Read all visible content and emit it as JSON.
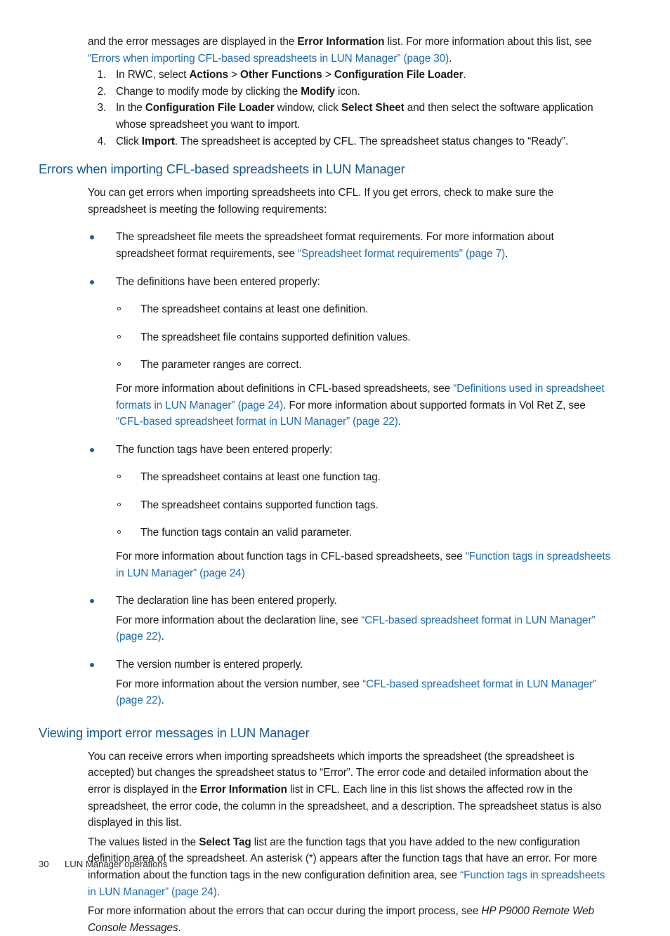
{
  "document": {
    "footer": {
      "page_number": "30",
      "chapter": "LUN Manager operations"
    }
  },
  "intro": {
    "line_a": "and the error messages are displayed in the ",
    "bold_a": "Error Information",
    "line_b": " list. For more information about this list, see ",
    "link_a": "“Errors when importing CFL-based spreadsheets in LUN Manager” (page 30)",
    "line_c": "."
  },
  "steps": [
    {
      "num": "1.",
      "pre": "In RWC, select ",
      "b1": "Actions",
      "sep1": " > ",
      "b2": "Other Functions",
      "sep2": " > ",
      "b3": "Configuration File Loader",
      "post": "."
    },
    {
      "num": "2.",
      "pre": "Change to modify mode by clicking the ",
      "b1": "Modify",
      "post": " icon."
    },
    {
      "num": "3.",
      "pre": "In the ",
      "b1": "Configuration File Loader",
      "mid": " window, click ",
      "b2": "Select Sheet",
      "post": " and then select the software application whose spreadsheet you want to import."
    },
    {
      "num": "4.",
      "pre": "Click ",
      "b1": "Import",
      "post": ". The spreadsheet is accepted by CFL. The spreadsheet status changes to “Ready”."
    }
  ],
  "section1": {
    "heading": "Errors when importing CFL-based spreadsheets in LUN Manager",
    "lead": "You can get errors when importing spreadsheets into CFL. If you get errors, check to make sure the spreadsheet is meeting the following requirements:",
    "bullet1": {
      "text": "The spreadsheet file meets the spreadsheet format requirements. For more information about spreadsheet format requirements, see ",
      "link": "“Spreadsheet format requirements” (page 7)",
      "tail": "."
    },
    "bullet2": {
      "text": "The definitions have been entered properly:",
      "subs": [
        "The spreadsheet contains at least one definition.",
        "The spreadsheet file contains supported definition values.",
        "The parameter ranges are correct."
      ],
      "note_pre": "For more information about definitions in CFL-based spreadsheets, see ",
      "note_link1": "“Definitions used in spreadsheet formats in LUN Manager” (page 24)",
      "note_mid": ". For more information about supported formats in Vol Ret Z, see ",
      "note_link2": "“CFL-based spreadsheet format in LUN Manager” (page 22)",
      "note_tail": "."
    },
    "bullet3": {
      "text": "The function tags have been entered properly:",
      "subs": [
        "The spreadsheet contains at least one function tag.",
        "The spreadsheet contains supported function tags.",
        "The function tags contain an valid parameter."
      ],
      "note_pre": "For more information about function tags in CFL-based spreadsheets, see ",
      "note_link1": "“Function tags in spreadsheets in LUN Manager” (page 24)",
      "note_tail": ""
    },
    "bullet4": {
      "text": "The declaration line has been entered properly.",
      "note_pre": "For more information about the declaration line, see ",
      "note_link1": "“CFL-based spreadsheet format in LUN Manager” (page 22)",
      "note_tail": "."
    },
    "bullet5": {
      "text": "The version number is entered properly.",
      "note_pre": "For more information about the version number, see ",
      "note_link1": "“CFL-based spreadsheet format in LUN Manager” (page 22)",
      "note_tail": "."
    }
  },
  "section2": {
    "heading": "Viewing import error messages in LUN Manager",
    "para1_a": "You can receive errors when importing spreadsheets which imports the spreadsheet (the spreadsheet is accepted) but changes the spreadsheet status to “Error”. The error code and detailed information about the error is displayed in the ",
    "para1_bold": "Error Information",
    "para1_b": " list in CFL. Each line in this list shows the affected row in the spreadsheet, the error code, the column in the spreadsheet, and a description. The spreadsheet status is also displayed in this list.",
    "para2_a": "The values listed in the ",
    "para2_bold": "Select Tag",
    "para2_b": " list are the function tags that you have added to the new configuration definition area of the spreadsheet. An asterisk (*) appears after the function tags that have an error. For more information about the function tags in the new configuration definition area, see ",
    "para2_link": "“Function tags in spreadsheets in LUN Manager” (page 24)",
    "para2_tail": ".",
    "para3_a": "For more information about the errors that can occur during the import process, see ",
    "para3_italic": "HP P9000 Remote Web Console Messages",
    "para3_tail": "."
  },
  "colors": {
    "link": "#1d6cb0",
    "heading": "#165891",
    "bullet": "#1d5fa0",
    "text": "#1c1c1c"
  }
}
